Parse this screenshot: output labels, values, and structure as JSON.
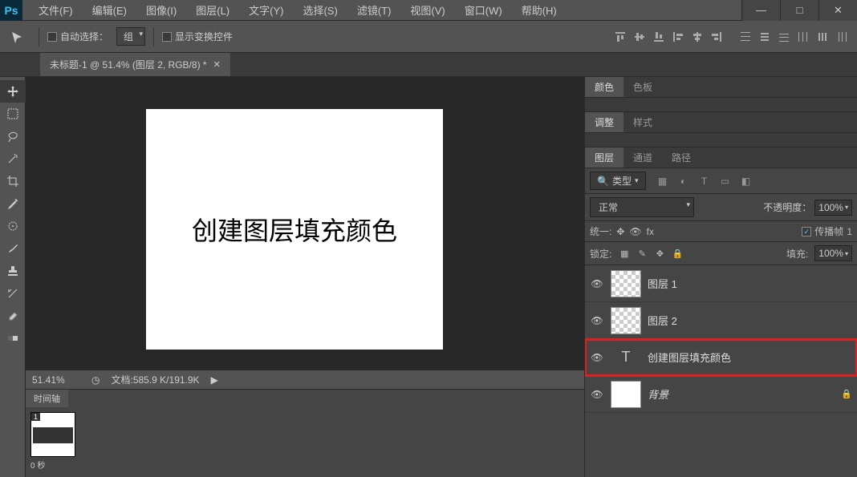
{
  "app": {
    "logo": "Ps"
  },
  "menu": [
    {
      "label": "文件(F)"
    },
    {
      "label": "编辑(E)"
    },
    {
      "label": "图像(I)"
    },
    {
      "label": "图层(L)"
    },
    {
      "label": "文字(Y)"
    },
    {
      "label": "选择(S)"
    },
    {
      "label": "滤镜(T)"
    },
    {
      "label": "视图(V)"
    },
    {
      "label": "窗口(W)"
    },
    {
      "label": "帮助(H)"
    }
  ],
  "window_controls": {
    "min": "—",
    "max": "□",
    "close": "✕"
  },
  "options": {
    "auto_select_label": "自动选择：",
    "auto_select_value": "组",
    "show_transform_label": "显示变换控件"
  },
  "document": {
    "tab_title": "未标题-1 @ 51.4% (图层 2, RGB/8) *",
    "canvas_text": "创建图层填充颜色"
  },
  "status": {
    "zoom": "51.41%",
    "doc_info": "文档:585.9 K/191.9K"
  },
  "timeline": {
    "tab": "时间轴",
    "frame_num": "1",
    "delay": "0 秒"
  },
  "panels": {
    "color_tabs": [
      "颜色",
      "色板"
    ],
    "adjust_tabs": [
      "调整",
      "样式"
    ],
    "layers_tabs": [
      "图层",
      "通道",
      "路径"
    ],
    "filter_label": "类型",
    "blend_mode": "正常",
    "opacity_label": "不透明度：",
    "opacity_value": "100%",
    "unify_label": "统一:",
    "propagate_label": "传播帧",
    "propagate_num": "1",
    "lock_label": "锁定:",
    "fill_label": "填充:",
    "fill_value": "100%"
  },
  "layers": [
    {
      "name": "图层 1",
      "type": "raster"
    },
    {
      "name": "图层 2",
      "type": "raster"
    },
    {
      "name": "创建图层填充颜色",
      "type": "text",
      "highlighted": true
    },
    {
      "name": "背景",
      "type": "bg",
      "locked": true,
      "italic": true
    }
  ]
}
